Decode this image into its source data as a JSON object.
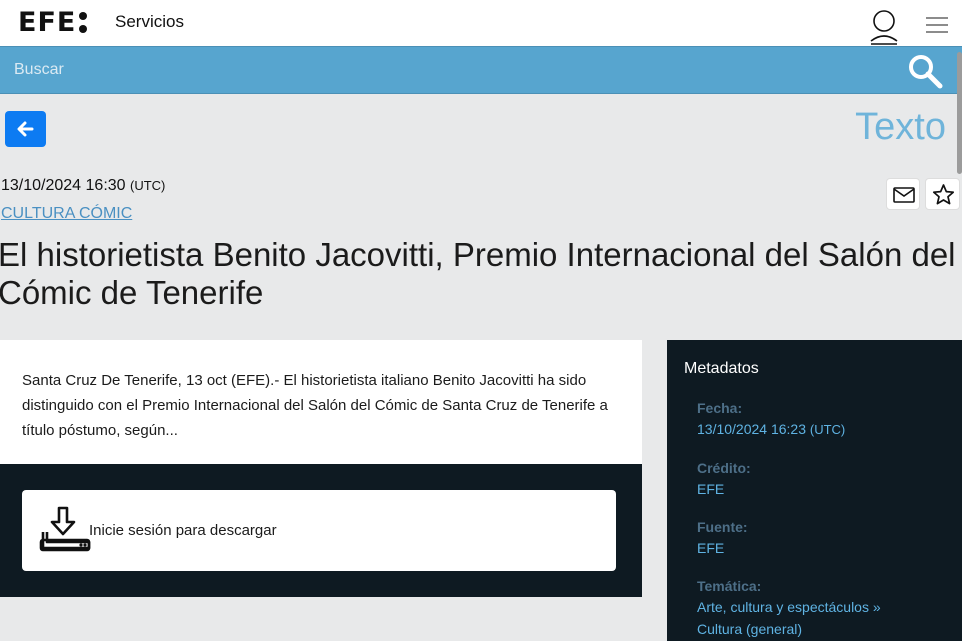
{
  "header": {
    "logo_text": "EFE",
    "service_label": "Servicios",
    "user_icon": "user-icon",
    "menu_icon": "hamburger-menu-icon"
  },
  "search": {
    "placeholder": "Buscar",
    "icon": "search-icon"
  },
  "toolbar": {
    "back_icon": "arrow-left-icon",
    "doc_type": "Texto",
    "mail_icon": "envelope-icon",
    "star_icon": "star-icon"
  },
  "article": {
    "datetime": "13/10/2024 16:30",
    "timezone": "(UTC)",
    "category": "CULTURA CÓMIC",
    "headline": "El historietista Benito Jacovitti, Premio Internacional del Salón del Cómic de Tenerife",
    "summary": "Santa Cruz De Tenerife, 13 oct (EFE).- El historietista italiano Benito Jacovitti ha sido distinguido con el Premio Internacional del Salón del Cómic de Santa Cruz de Tenerife a título póstumo, según..."
  },
  "download": {
    "label": "Inicie sesión para descargar",
    "icon": "download-tray-icon"
  },
  "metadata": {
    "title": "Metadatos",
    "date_label": "Fecha:",
    "date_value": "13/10/2024 16:23",
    "date_tz": "(UTC)",
    "credit_label": "Crédito:",
    "credit_value": "EFE",
    "source_label": "Fuente:",
    "source_value": "EFE",
    "topic_label": "Temática:",
    "topic_value_1": "Arte, cultura y espectáculos »",
    "topic_value_2": "Cultura (general)"
  },
  "colors": {
    "search_bar": "#57a5cf",
    "back_button": "#0d7bf2",
    "dark_panel": "#0e1a22",
    "link": "#5fb3e3",
    "page_bg": "#e8e9ea"
  }
}
